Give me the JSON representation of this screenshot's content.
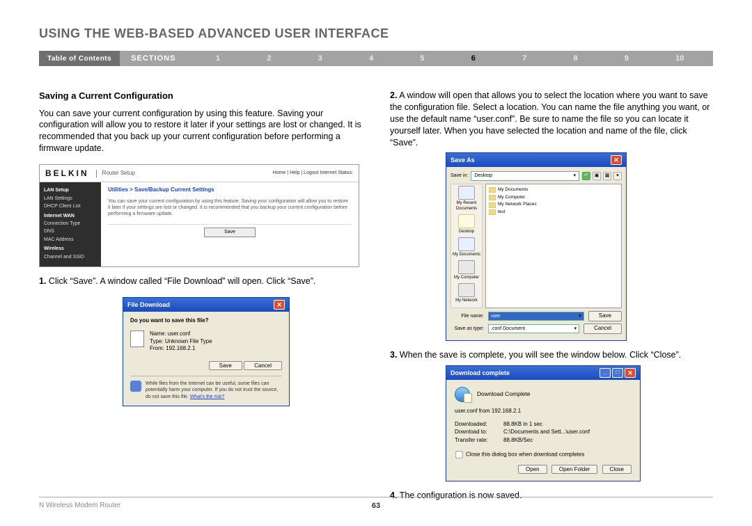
{
  "header": {
    "title": "USING THE WEB-BASED ADVANCED USER INTERFACE"
  },
  "nav": {
    "toc": "Table of Contents",
    "sections": "SECTIONS",
    "items": [
      "1",
      "2",
      "3",
      "4",
      "5",
      "6",
      "7",
      "8",
      "9",
      "10"
    ],
    "active_index": 5
  },
  "left": {
    "subhead": "Saving a Current Configuration",
    "intro": "You can save your current configuration by using this feature. Saving your configuration will allow you to restore it later if your settings are lost or changed. It is recommended that you back up your current configuration before performing a firmware update.",
    "step1_num": "1.",
    "step1_text": " Click “Save”. A window called “File Download” will open. Click “Save”."
  },
  "router": {
    "logo": "BELKIN",
    "setup": "Router Setup",
    "links": "Home | Help | Logout   Internet Status:",
    "sidebar": {
      "lan_setup": "LAN Setup",
      "lan_settings": "LAN Settings",
      "dhcp": "DHCP Client List",
      "internet_wan": "Internet WAN",
      "conn_type": "Connection Type",
      "dns": "DNS",
      "mac": "MAC Address",
      "wireless": "Wireless",
      "channel": "Channel and SSID"
    },
    "breadcrumb": "Utilities > Save/Backup Current Settings",
    "desc": "You can save your current configuration by using this feature. Saving your configuration will allow you to restore it later if your settings are lost or changed. It is recommended that you backup your current configuration before performing a firmware update.",
    "save_btn": "Save"
  },
  "filedl": {
    "title": "File Download",
    "question": "Do you want to save this file?",
    "name_lbl": "Name:",
    "name": "user.conf",
    "type_lbl": "Type:",
    "type": "Unknown File Type",
    "from_lbl": "From:",
    "from": "192.168.2.1",
    "save": "Save",
    "cancel": "Cancel",
    "warn": "While files from the Internet can be useful, some files can potentially harm your computer. If you do not trust the source, do not save this file. ",
    "risk": "What's the risk?"
  },
  "right": {
    "step2_num": "2.",
    "step2_text": " A window will open that allows you to select the location where you want to save the configuration file. Select a location. You can name the file anything you want, or use the default name “user.conf”. Be sure to name the file so you can locate it yourself later. When you have selected the location and name of the file, click “Save”.",
    "step3_num": "3.",
    "step3_text": " When the save is complete, you will see the window below. Click “Close”.",
    "step4_num": "4.",
    "step4_text": " The configuration is now saved."
  },
  "saveas": {
    "title": "Save As",
    "savein_lbl": "Save in:",
    "savein_val": "Desktop",
    "items": [
      "My Documents",
      "My Computer",
      "My Network Places",
      "test"
    ],
    "places": [
      "My Recent Documents",
      "Desktop",
      "My Documents",
      "My Computer",
      "My Network"
    ],
    "filename_lbl": "File name:",
    "filename_val": "user",
    "savetype_lbl": "Save as type:",
    "savetype_val": ".conf Document",
    "save": "Save",
    "cancel": "Cancel"
  },
  "dlcomp": {
    "title": "Download complete",
    "heading": "Download Complete",
    "file": "user.conf from 192.168.2.1",
    "downloaded_lbl": "Downloaded:",
    "downloaded": "88.8KB in 1 sec",
    "to_lbl": "Download to:",
    "to": "C:\\Documents and Sett...\\user.conf",
    "rate_lbl": "Transfer rate:",
    "rate": "88.8KB/Sec",
    "checkbox": "Close this dialog box when download completes",
    "open": "Open",
    "open_folder": "Open Folder",
    "close": "Close"
  },
  "footer": {
    "product": "N Wireless Modem Router",
    "page": "63"
  }
}
